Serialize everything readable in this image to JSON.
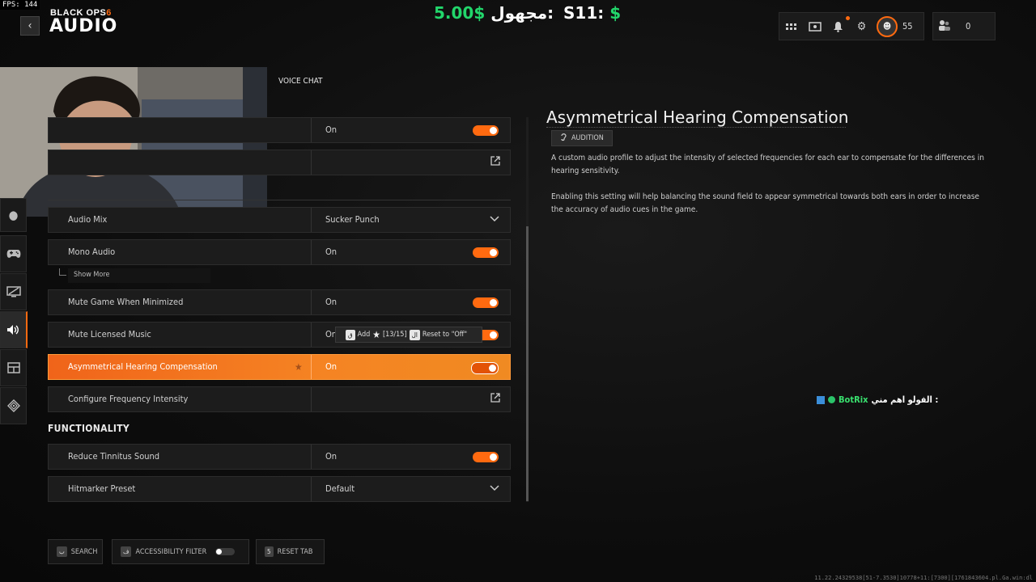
{
  "fps": "FPS: 144",
  "header": {
    "logo": "BLACK OPS",
    "logo_num": "6",
    "title": "AUDIO",
    "back_icon": "chevron-left-icon"
  },
  "overlay": {
    "money_value": "5.00$",
    "money_label": "مجهول:",
    "s11_label": "S11:",
    "s11_value": "$"
  },
  "topbar": {
    "level": "55",
    "party_count": "0",
    "accent": "#ff6a10"
  },
  "tabs": {
    "voice_chat": "VOICE CHAT"
  },
  "settings": {
    "row_top1_value": "On",
    "audio_mix_label": "Audio Mix",
    "audio_mix_value": "Sucker Punch",
    "mono_audio_label": "Mono Audio",
    "mono_audio_value": "On",
    "show_more": "Show More",
    "mute_minimized_label": "Mute Game When Minimized",
    "mute_minimized_value": "On",
    "mute_music_label": "Mute Licensed Music",
    "mute_music_value": "On",
    "ahc_label": "Asymmetrical Hearing Compensation",
    "ahc_value": "On",
    "cfi_label": "Configure Frequency Intensity"
  },
  "tooltip": {
    "add_key": "ق",
    "add_label": "Add",
    "count": "[13/15]",
    "reset_key": "ال",
    "reset_label": "Reset to \"Off\""
  },
  "functionality": {
    "heading": "FUNCTIONALITY",
    "tinnitus_label": "Reduce Tinnitus Sound",
    "tinnitus_value": "On",
    "hitmarker_label": "Hitmarker Preset",
    "hitmarker_value": "Default"
  },
  "detail": {
    "title": "Asymmetrical Hearing Compensation",
    "tag": "AUDITION",
    "para1": "A custom audio profile to adjust the intensity of selected frequencies for each ear to compensate for the differences in hearing sensitivity.",
    "para2": "Enabling this setting will help balancing the sound field to appear symmetrical towards both ears in order to increase the accuracy of audio cues in the game."
  },
  "chat": {
    "name": "BotRix",
    "message": "الفولو اهم مني :"
  },
  "footer": {
    "search_key": "ب",
    "search_label": "SEARCH",
    "filter_key": "ف",
    "filter_label": "ACCESSIBILITY FILTER",
    "reset_key": "5",
    "reset_label": "RESET TAB"
  },
  "debug": "11.22.24329538[51-7.3530]10778+11:[7300][1761843604.pl.Ga.win:dl"
}
